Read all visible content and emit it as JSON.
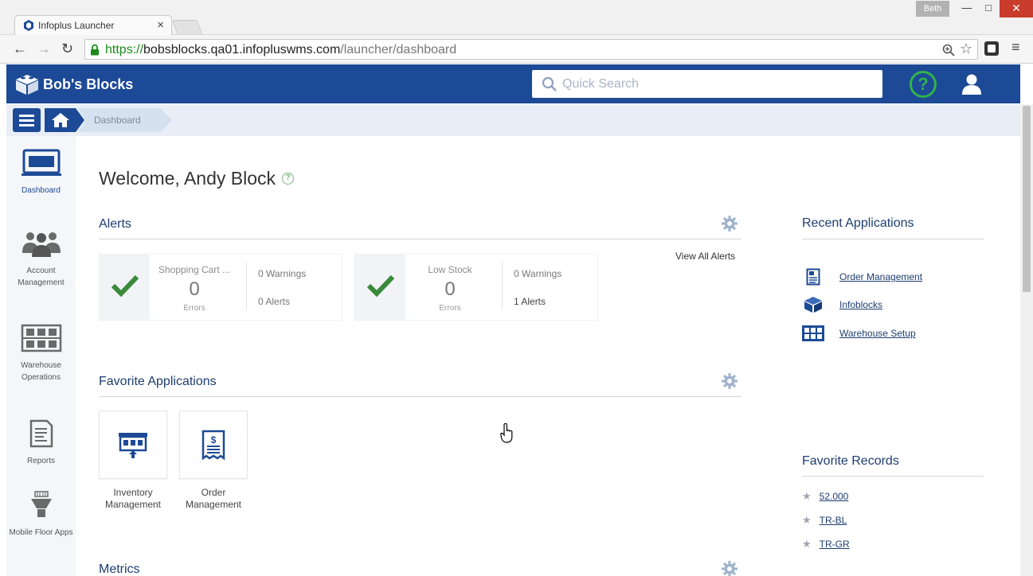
{
  "browser": {
    "tab_title": "Infoplus Launcher",
    "tab_close": "×",
    "profile_name": "Beth",
    "url_scheme": "https://",
    "url_host": "bobsblocks.qa01.infopluswms.com",
    "url_path": "/launcher/dashboard",
    "back": "←",
    "forward": "→",
    "reload": "↻",
    "win_min": "—",
    "win_max": "□",
    "win_close": "✕",
    "menu": "≡"
  },
  "header": {
    "brand": "Bob's Blocks",
    "search_placeholder": "Quick Search",
    "help": "?"
  },
  "breadcrumb": {
    "current": "Dashboard"
  },
  "sidebar": {
    "items": [
      {
        "label": "Dashboard",
        "icon": "monitor-icon"
      },
      {
        "label": "Account Management",
        "icon": "users-icon"
      },
      {
        "label": "Warehouse Operations",
        "icon": "warehouse-icon"
      },
      {
        "label": "Reports",
        "icon": "report-icon"
      },
      {
        "label": "Mobile Floor Apps",
        "icon": "mobile-floor-icon"
      }
    ]
  },
  "main": {
    "welcome": "Welcome, Andy Block",
    "alerts_title": "Alerts",
    "view_all": "View All Alerts",
    "alerts": [
      {
        "title": "Shopping Cart ...",
        "count": "0",
        "count_label": "Errors",
        "warnings": "0 Warnings",
        "alerts": "0 Alerts"
      },
      {
        "title": "Low Stock",
        "count": "0",
        "count_label": "Errors",
        "warnings": "0 Warnings",
        "alerts": "1 Alerts"
      }
    ],
    "favorites_title": "Favorite Applications",
    "favorites": [
      {
        "label": "Inventory Management",
        "icon": "inventory-icon"
      },
      {
        "label": "Order Management",
        "icon": "order-receipt-icon"
      }
    ],
    "metrics_title": "Metrics"
  },
  "right": {
    "recent_title": "Recent Applications",
    "recent": [
      {
        "label": "Order Management",
        "icon": "order-doc-icon"
      },
      {
        "label": "Infoblocks",
        "icon": "infoblocks-icon"
      },
      {
        "label": "Warehouse Setup",
        "icon": "warehouse-setup-icon"
      }
    ],
    "favorite_records_title": "Favorite Records",
    "favorite_records": [
      "52.000",
      "TR-BL",
      "TR-GR"
    ]
  },
  "colors": {
    "brand_blue": "#1d4a96",
    "help_green": "#2fb34a",
    "check_green": "#3a8a3a"
  }
}
